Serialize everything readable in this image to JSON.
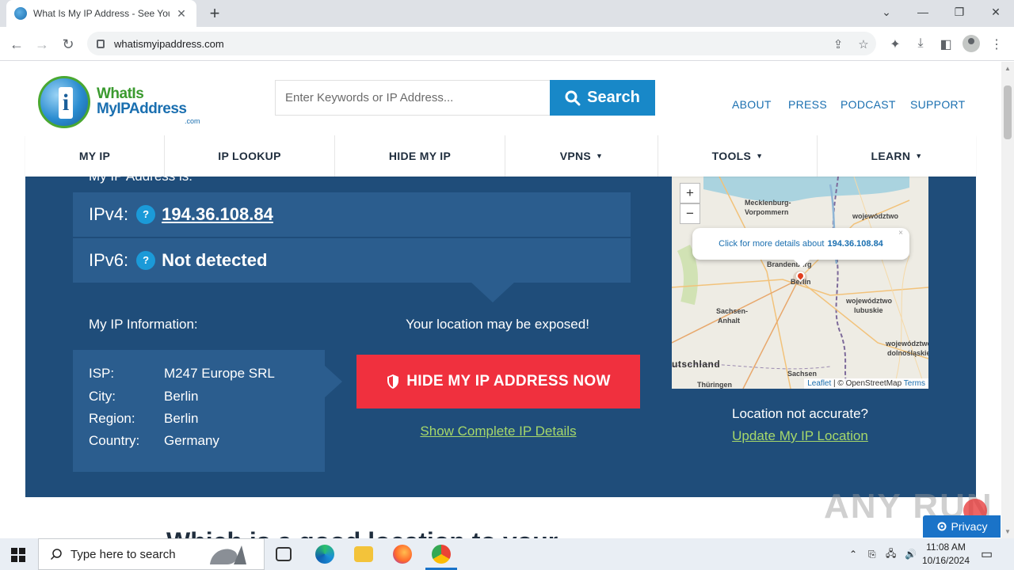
{
  "browser": {
    "tab_title": "What Is My IP Address - See Your",
    "url": "whatismyipaddress.com"
  },
  "site": {
    "logo": {
      "line1": "WhatIs",
      "line2": "MyIPAddress",
      "suffix": ".com"
    },
    "search": {
      "placeholder": "Enter Keywords or IP Address...",
      "button_label": "Search"
    },
    "top_links": [
      "ABOUT",
      "PRESS",
      "PODCAST",
      "SUPPORT"
    ],
    "nav": [
      {
        "label": "MY IP",
        "dropdown": false
      },
      {
        "label": "IP LOOKUP",
        "dropdown": false
      },
      {
        "label": "HIDE MY IP",
        "dropdown": false
      },
      {
        "label": "VPNS",
        "dropdown": true
      },
      {
        "label": "TOOLS",
        "dropdown": true
      },
      {
        "label": "LEARN",
        "dropdown": true
      }
    ]
  },
  "ip_panel": {
    "partial_heading": "My IP Address is:",
    "ipv4_label": "IPv4:",
    "ipv4_value": "194.36.108.84",
    "ipv6_label": "IPv6:",
    "ipv6_value": "Not detected",
    "help_glyph": "?",
    "info_title": "My IP Information:",
    "info": [
      {
        "key": "ISP:",
        "value": "M247 Europe SRL"
      },
      {
        "key": "City:",
        "value": "Berlin"
      },
      {
        "key": "Region:",
        "value": "Berlin"
      },
      {
        "key": "Country:",
        "value": "Germany"
      }
    ],
    "exposed_text": "Your location may be exposed!",
    "hide_button": "HIDE MY IP ADDRESS NOW",
    "complete_link": "Show Complete IP Details",
    "location_question": "Location not accurate?",
    "update_link": "Update My IP Location"
  },
  "map": {
    "zoom_in": "+",
    "zoom_out": "−",
    "popup_prefix": "Click for more details about",
    "popup_ip": "194.36.108.84",
    "popup_close": "×",
    "labels": {
      "mv1": "Mecklenburg-",
      "mv2": "Vorpommern",
      "woj1": "województwo",
      "brand": "Brandenburg",
      "berlin": "Berlin",
      "lub1": "województwo",
      "lub2": "lubuskie",
      "sa1": "Sachsen-",
      "sa2": "Anhalt",
      "ds1": "województwo",
      "ds2": "dolnośląskie",
      "de": "utschland",
      "sachsen": "Sachsen",
      "thur": "Thüringen"
    },
    "attribution": {
      "leaflet": "Leaflet",
      "sep": " | © OpenStreetMap ",
      "terms": "Terms"
    }
  },
  "bottom_heading": "Which is a good location to your ...",
  "watermark": "ANY RUN",
  "privacy_label": "Privacy",
  "taskbar": {
    "search_placeholder": "Type here to search",
    "time": "11:08 AM",
    "date": "10/16/2024"
  },
  "colors": {
    "panel": "#1f4d7a",
    "row": "#2b5d8e",
    "search_blue": "#1888c8",
    "hide_red": "#f0303e",
    "link_green": "#a6d86a"
  }
}
